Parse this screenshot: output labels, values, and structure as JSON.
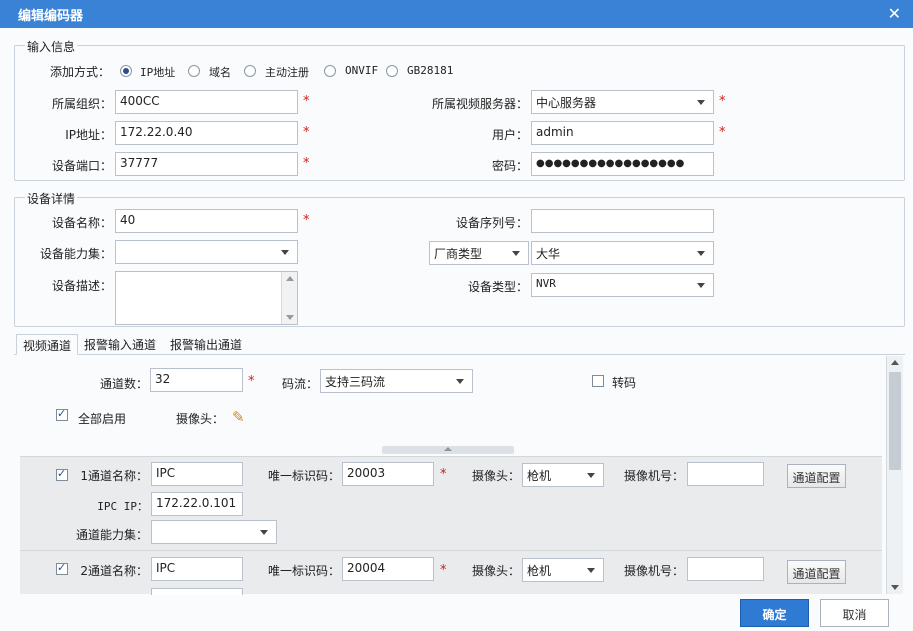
{
  "window": {
    "title": "编辑编码器",
    "close_label": "✕"
  },
  "input_info": {
    "legend": "输入信息",
    "add_mode_label": "添加方式：",
    "add_modes": [
      "IP地址",
      "域名",
      "主动注册",
      "ONVIF",
      "GB28181"
    ],
    "selected_mode": "IP地址",
    "org_label": "所属组织：",
    "org_value": "400CC",
    "ip_label": "IP地址：",
    "ip_value": "172.22.0.40",
    "port_label": "设备端口：",
    "port_value": "37777",
    "server_label": "所属视频服务器：",
    "server_value": "中心服务器",
    "user_label": "用户：",
    "user_value": "admin",
    "password_label": "密码：",
    "password_value": "●●●●●●●●●●●●●●●●●"
  },
  "device_details": {
    "legend": "设备详情",
    "name_label": "设备名称：",
    "name_value": "40",
    "capability_label": "设备能力集：",
    "capability_value": "",
    "desc_label": "设备描述：",
    "desc_value": "",
    "serial_label": "设备序列号：",
    "serial_value": "",
    "vendor_type_label": "厂商类型",
    "vendor_value": "大华",
    "devtype_label": "设备类型：",
    "devtype_value": "NVR"
  },
  "tabs": [
    "视频通道",
    "报警输入通道",
    "报警输出通道"
  ],
  "video": {
    "channel_count_label": "通道数：",
    "channel_count_value": "32",
    "stream_label": "码流：",
    "stream_value": "支持三码流",
    "transcode_label": "转码",
    "enable_all_label": "全部启用",
    "camera_label": "摄像头："
  },
  "channels": [
    {
      "name_label": "1通道名称：",
      "name_value": "IPC",
      "uid_label": "唯一标识码：",
      "uid_value": "20003",
      "camera_label": "摄像头：",
      "camera_value": "枪机",
      "camera_no_label": "摄像机号：",
      "camera_no_value": "",
      "config_button": "通道配置",
      "ipc_ip_label": "IPC IP：",
      "ipc_ip_value": "172.22.0.101",
      "capability_label": "通道能力集：",
      "capability_value": ""
    },
    {
      "name_label": "2通道名称：",
      "name_value": "IPC",
      "uid_label": "唯一标识码：",
      "uid_value": "20004",
      "camera_label": "摄像头：",
      "camera_value": "枪机",
      "camera_no_label": "摄像机号：",
      "camera_no_value": "",
      "config_button": "通道配置"
    }
  ],
  "footer": {
    "ok": "确定",
    "cancel": "取消"
  },
  "required_mark": "*",
  "colors": {
    "titlebar": "#3a82d6",
    "required": "#d31a1a",
    "ok_button": "#2f7ad3"
  }
}
